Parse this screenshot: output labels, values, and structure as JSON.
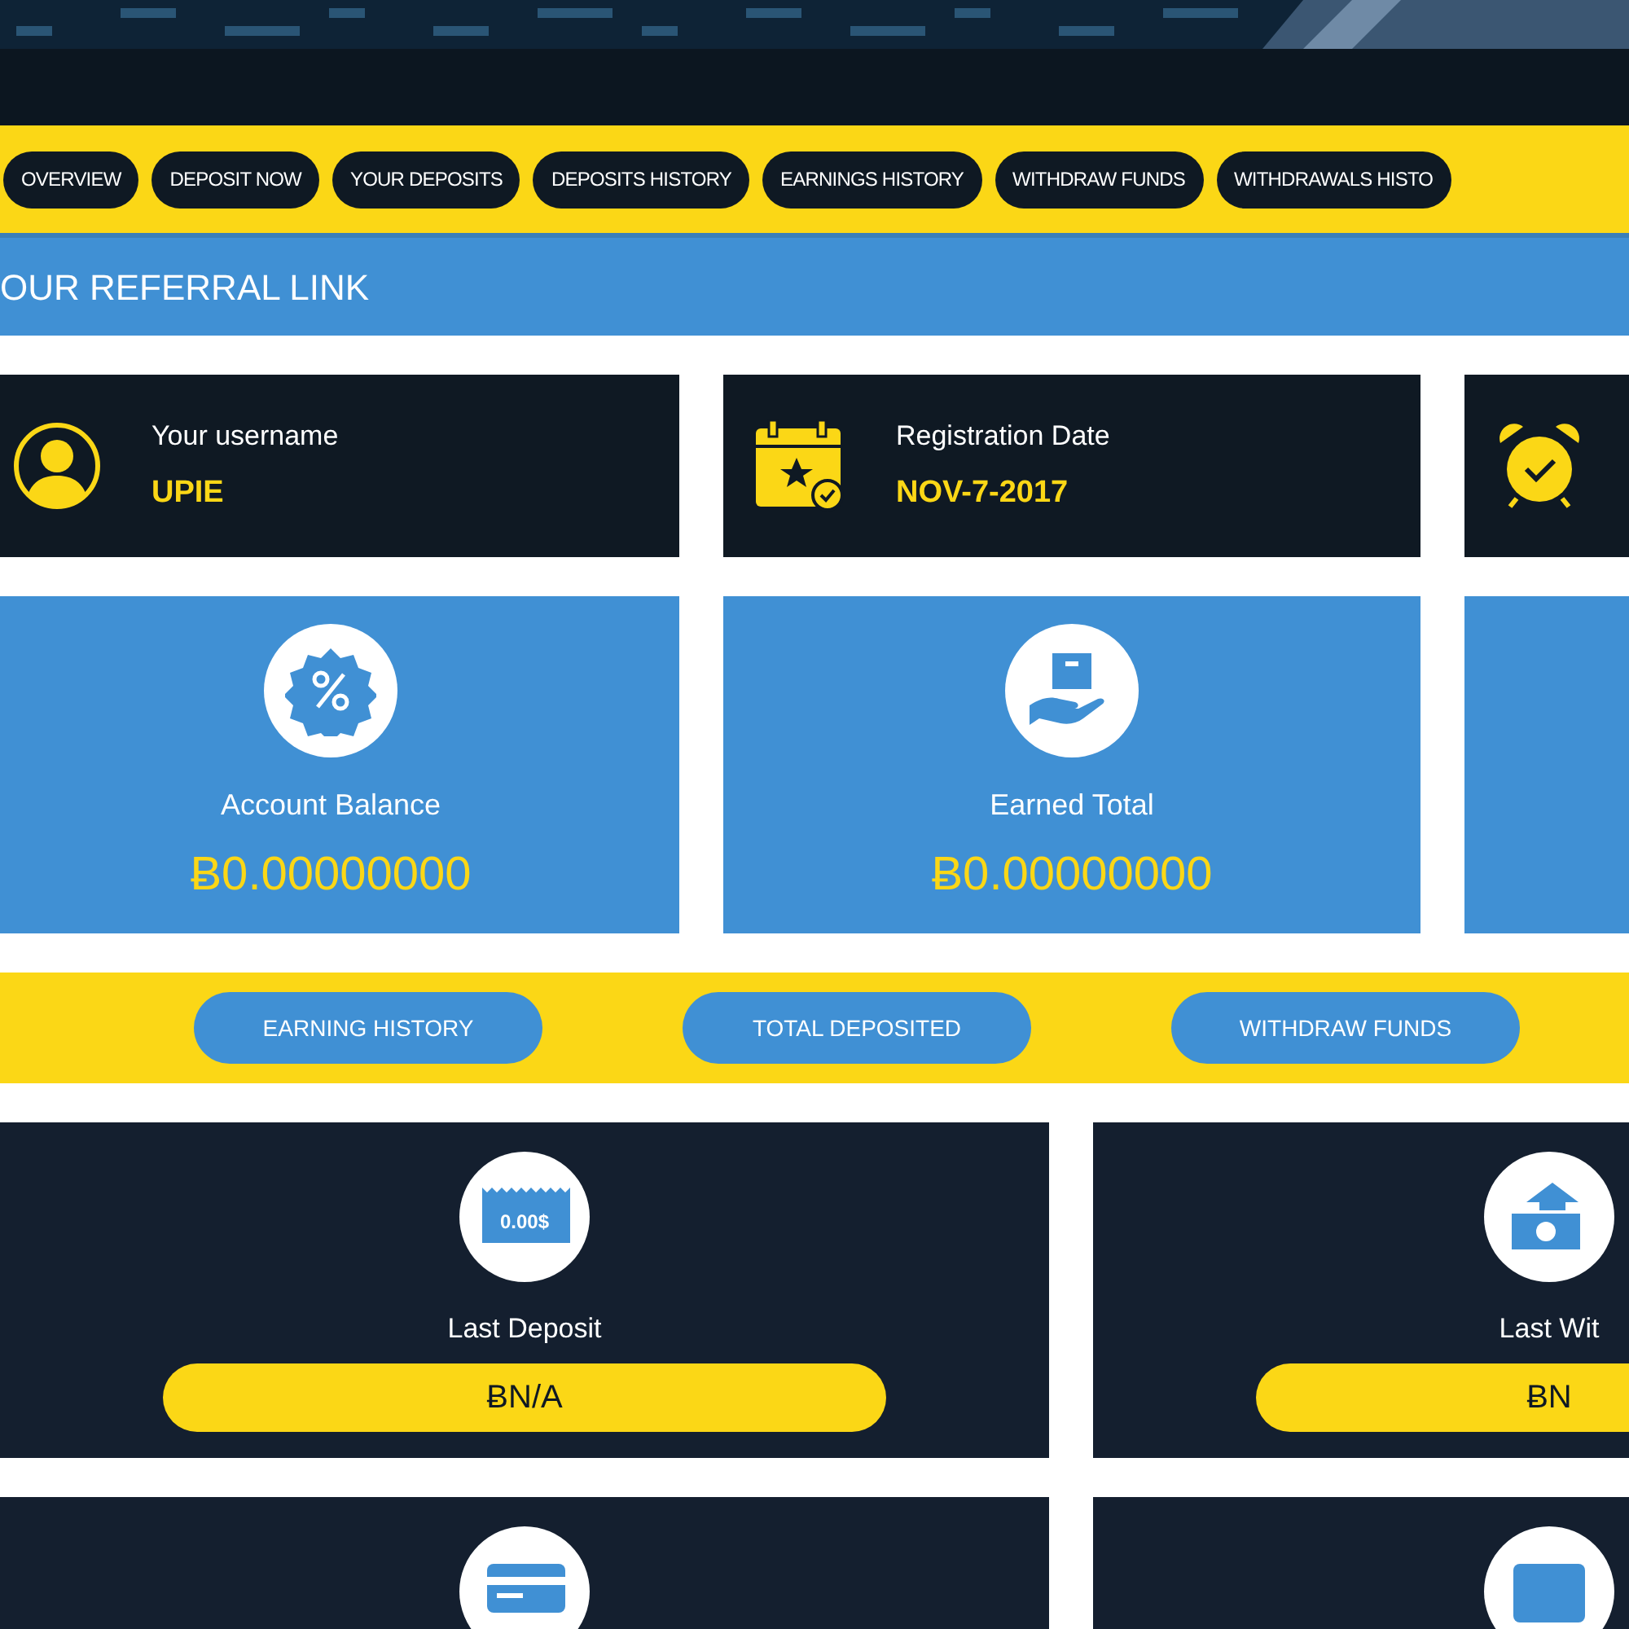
{
  "nav_tabs": [
    {
      "label": "OVERVIEW"
    },
    {
      "label": "DEPOSIT NOW"
    },
    {
      "label": "YOUR DEPOSITS"
    },
    {
      "label": "DEPOSITS HISTORY"
    },
    {
      "label": "EARNINGS HISTORY"
    },
    {
      "label": "WITHDRAW FUNDS"
    },
    {
      "label": "WITHDRAWALS HISTO"
    }
  ],
  "referral_bar": {
    "title": "OUR REFERRAL LINK"
  },
  "info_cards": [
    {
      "label": "Your username",
      "value": "UPIE"
    },
    {
      "label": "Registration Date",
      "value": "NOV-7-2017"
    }
  ],
  "balance_cards": [
    {
      "label": "Account Balance",
      "value": "Ƀ0.00000000"
    },
    {
      "label": "Earned Total",
      "value": "Ƀ0.00000000"
    }
  ],
  "quick_links": [
    "EARNING HISTORY",
    "TOTAL DEPOSITED",
    "WITHDRAW FUNDS"
  ],
  "stat_cards": [
    {
      "icon_text": "0.00$",
      "label": "Last Deposit",
      "value": "ɃN/A"
    },
    {
      "label": "Last Wit",
      "value": "ɃN"
    }
  ]
}
